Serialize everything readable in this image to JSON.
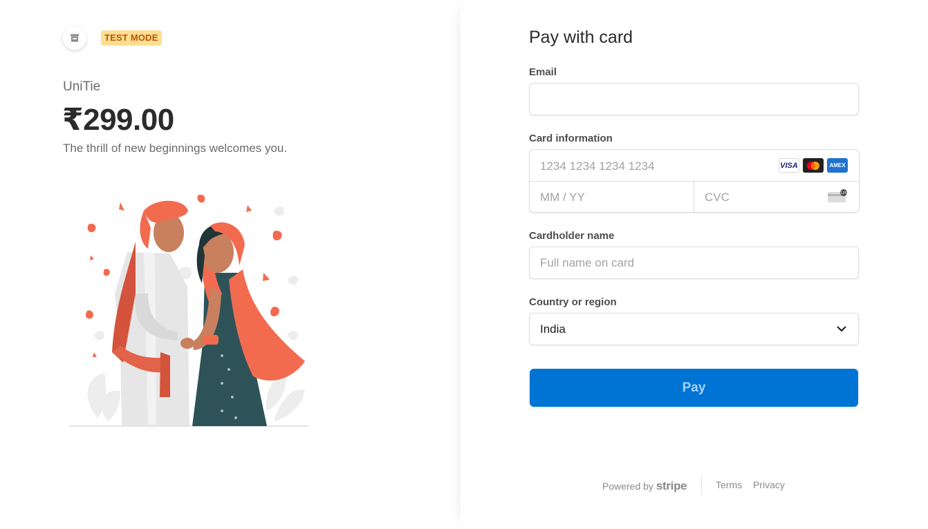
{
  "merchant": {
    "icon": "store-icon",
    "badge": "TEST MODE",
    "product_name": "UniTie",
    "price": "₹299.00",
    "description": "The thrill of new beginnings welcomes you.",
    "illustration": "wedding-couple-illustration"
  },
  "form": {
    "title": "Pay with card",
    "email_label": "Email",
    "email_value": "",
    "card_label": "Card information",
    "card_number_placeholder": "1234 1234 1234 1234",
    "expiry_placeholder": "MM / YY",
    "cvc_placeholder": "CVC",
    "card_brands": [
      "VISA",
      "mastercard",
      "AMEX"
    ],
    "cardholder_label": "Cardholder name",
    "cardholder_placeholder": "Full name on card",
    "country_label": "Country or region",
    "country_value": "India",
    "pay_label": "Pay"
  },
  "footer": {
    "powered_by": "Powered by",
    "brand": "stripe",
    "terms": "Terms",
    "privacy": "Privacy"
  },
  "colors": {
    "accent": "#0074d4",
    "badge_bg": "#ffde92",
    "badge_text": "#bb5504",
    "illustration_primary": "#f26b4f",
    "illustration_dark": "#2d5358"
  }
}
